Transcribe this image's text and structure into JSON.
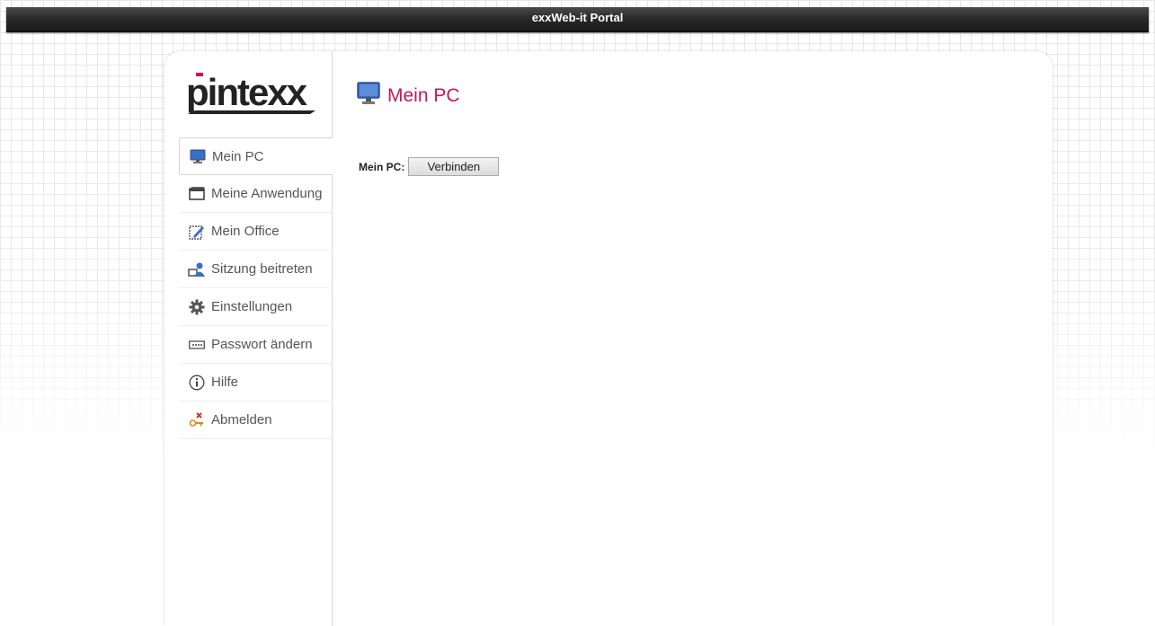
{
  "window": {
    "title": "exxWeb-it Portal"
  },
  "brand": {
    "logo_text": "pintexx",
    "accent": "#c2185b"
  },
  "sidebar": {
    "items": [
      {
        "label": "Mein PC",
        "icon": "monitor-icon",
        "active": true
      },
      {
        "label": "Meine Anwendung",
        "icon": "window-icon",
        "active": false
      },
      {
        "label": "Mein Office",
        "icon": "edit-document-icon",
        "active": false
      },
      {
        "label": "Sitzung beitreten",
        "icon": "join-session-icon",
        "active": false
      },
      {
        "label": "Einstellungen",
        "icon": "gear-icon",
        "active": false
      },
      {
        "label": "Passwort ändern",
        "icon": "password-field-icon",
        "active": false
      },
      {
        "label": "Hilfe",
        "icon": "info-icon",
        "active": false
      },
      {
        "label": "Abmelden",
        "icon": "logout-key-icon",
        "active": false
      }
    ]
  },
  "main": {
    "title": "Mein PC",
    "title_icon": "monitor-icon",
    "form": {
      "label": "Mein PC:",
      "button_label": "Verbinden"
    }
  }
}
